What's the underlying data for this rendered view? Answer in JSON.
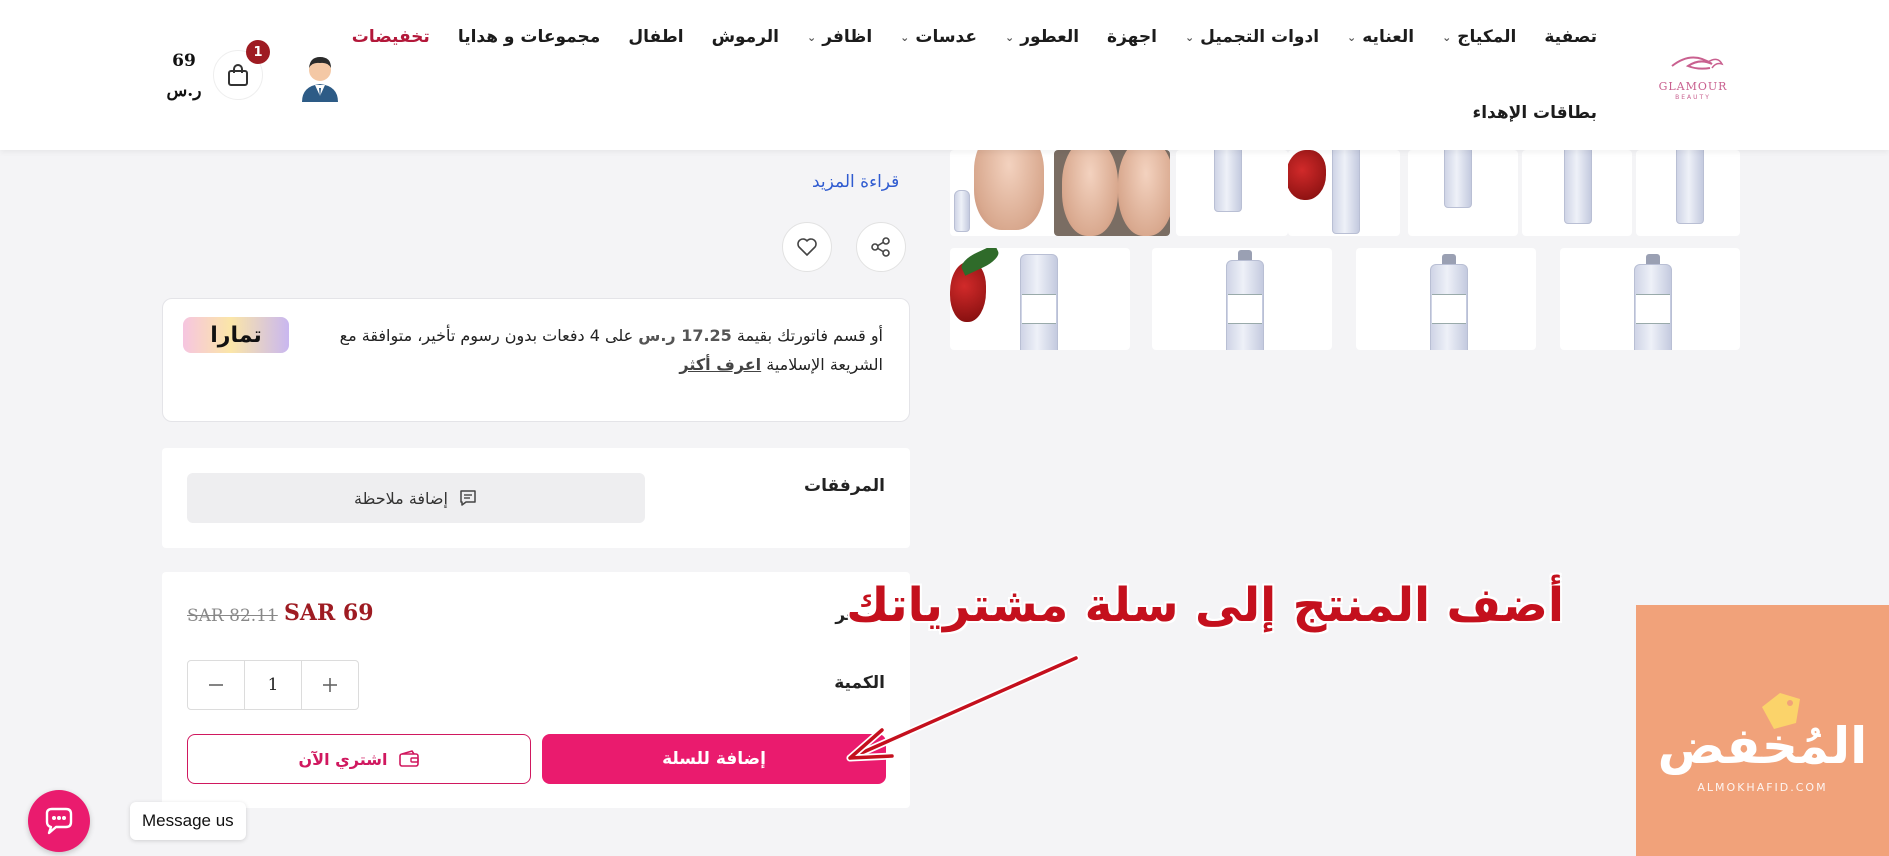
{
  "header": {
    "logo_text": "GLAMOUR",
    "logo_sub": "BEAUTY",
    "nav_row1": [
      {
        "label": "تصفية",
        "dropdown": false
      },
      {
        "label": "المكياج",
        "dropdown": true
      },
      {
        "label": "العنايه",
        "dropdown": true
      },
      {
        "label": "ادوات التجميل",
        "dropdown": true
      },
      {
        "label": "اجهزة",
        "dropdown": false
      },
      {
        "label": "العطور",
        "dropdown": true
      },
      {
        "label": "عدسات",
        "dropdown": true
      },
      {
        "label": "اظافر",
        "dropdown": true
      },
      {
        "label": "الرموش",
        "dropdown": false
      },
      {
        "label": "اطفال",
        "dropdown": false
      },
      {
        "label": "مجموعات و هدايا",
        "dropdown": false
      },
      {
        "label": "تخفيضات",
        "dropdown": false
      }
    ],
    "nav_row2": [
      {
        "label": "بطاقات الإهداء",
        "dropdown": false
      }
    ],
    "cart_count": "1",
    "cart_total_value": "69",
    "cart_total_currency": "ر.س"
  },
  "product": {
    "read_more": "قراءة المزيد",
    "tamara": {
      "logo": "تمارا",
      "text_before": "أو قسم فاتورتك بقيمة ",
      "amount": "17.25 ر.س",
      "text_after": " على 4 دفعات بدون رسوم تأخير، متوافقة مع الشريعة الإسلامية ",
      "link": "اعرف أكثر"
    },
    "attachments_label": "المرفقات",
    "add_note": "إضافة ملاحظة",
    "price_label": "السعر",
    "price_now": "SAR 69",
    "price_old": "SAR 82.11",
    "quantity_label": "الكمية",
    "quantity": "1",
    "add_to_cart": "إضافة للسلة",
    "buy_now": "اشتري الآن"
  },
  "annotation": "أضف المنتج  إلى سلة مشترياتك",
  "promo": {
    "title": "المُخفض",
    "subtitle": "ALMOKHAFID.COM"
  },
  "chat": {
    "label": "Message us"
  },
  "colors": {
    "accent": "#ea1b6e",
    "price": "#9e1b22",
    "sale_nav": "#b3183a",
    "annotation": "#c4101d",
    "promo_bg": "#f1a27a"
  }
}
